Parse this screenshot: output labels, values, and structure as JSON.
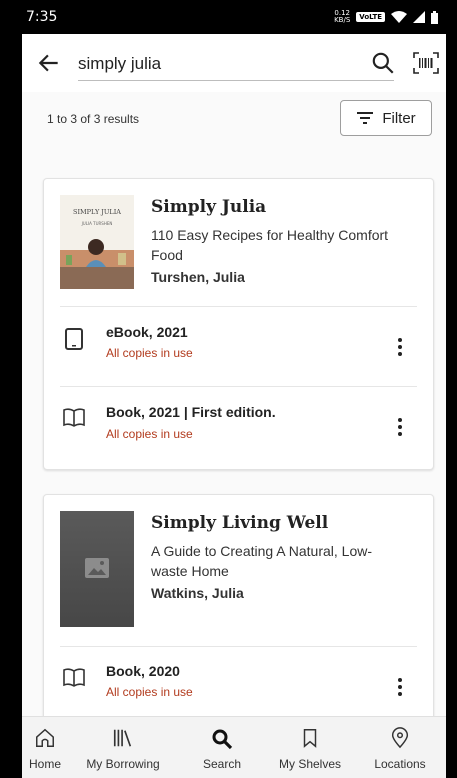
{
  "status_bar": {
    "time": "7:35",
    "speed_value": "0.12",
    "speed_unit": "KB/S",
    "network": "VoLTE"
  },
  "search": {
    "query": "simply julia"
  },
  "results": {
    "count_text": "1 to 3 of 3 results",
    "filter_label": "Filter"
  },
  "items": [
    {
      "title": "Simply Julia",
      "subtitle": "110 Easy Recipes for Healthy Comfort Food",
      "author": "Turshen, Julia",
      "cover_text": "SIMPLY JULIA",
      "cover_sub": "JULIA TURSHEN",
      "formats": [
        {
          "label": "eBook, 2021",
          "status": "All copies in use",
          "icon": "tablet-icon"
        },
        {
          "label": "Book, 2021 | First edition.",
          "status": "All copies in use",
          "icon": "book-icon"
        }
      ]
    },
    {
      "title": "Simply Living Well",
      "subtitle": "A Guide to Creating A Natural, Low-waste Home",
      "author": "Watkins, Julia",
      "formats": [
        {
          "label": "Book, 2020",
          "status": "All copies in use",
          "icon": "book-icon"
        }
      ]
    }
  ],
  "nav": [
    {
      "label": "Home",
      "icon": "home-icon"
    },
    {
      "label": "My Borrowing",
      "icon": "library-icon"
    },
    {
      "label": "Search",
      "icon": "search-icon"
    },
    {
      "label": "My Shelves",
      "icon": "bookmark-icon"
    },
    {
      "label": "Locations",
      "icon": "location-pin-icon"
    }
  ],
  "colors": {
    "status_red": "#b23b1e",
    "background": "#fafafa"
  }
}
